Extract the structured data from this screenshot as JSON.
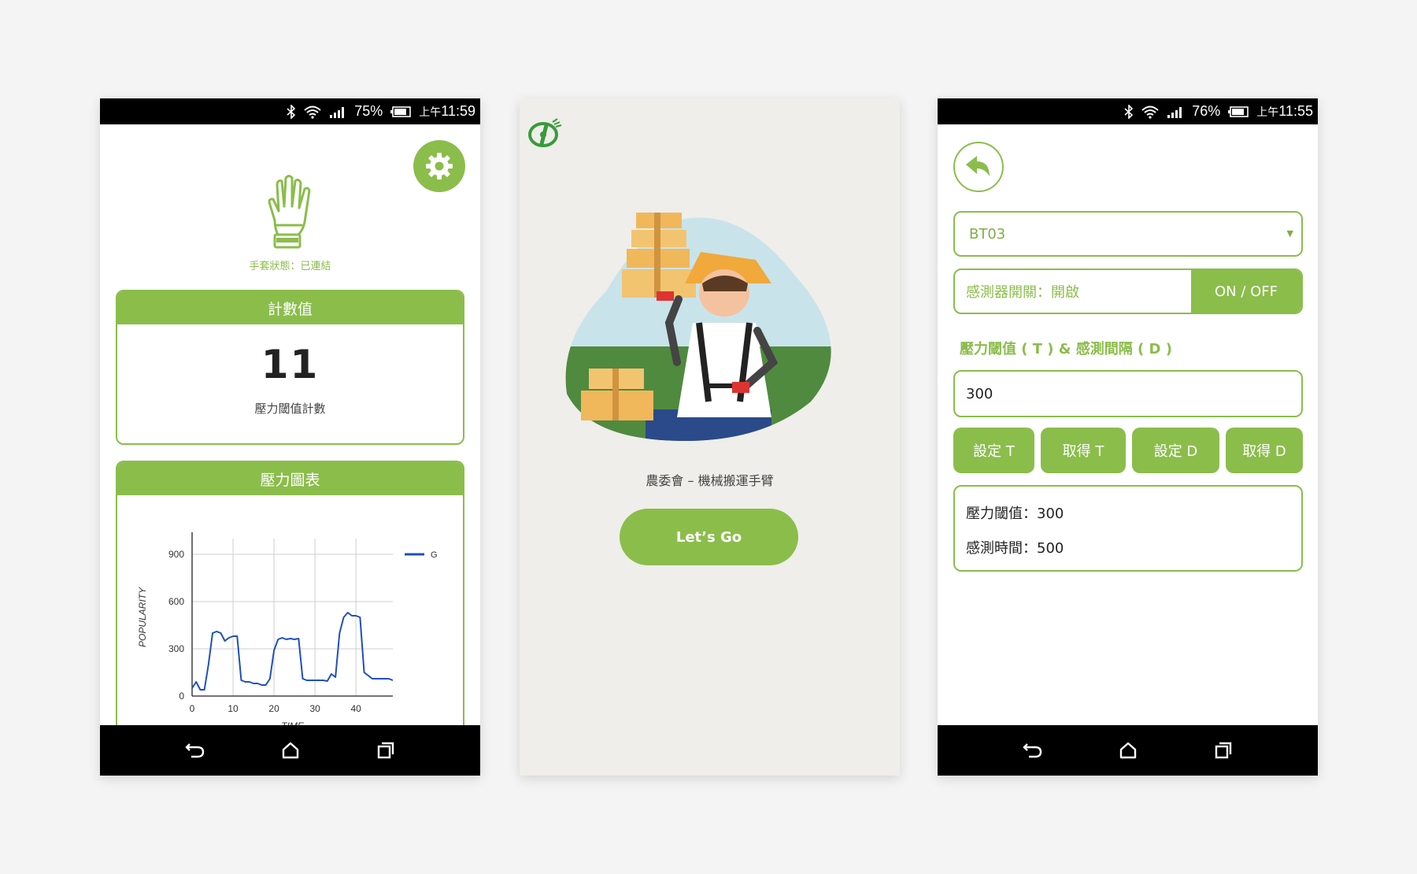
{
  "colors": {
    "accent": "#8bbd4b",
    "chart_line": "#1f4fbf"
  },
  "screen1": {
    "status": {
      "battery": "75%",
      "time_prefix": "上午",
      "time": "11:59"
    },
    "glove_status": "手套狀態：已連結",
    "count_card": {
      "title": "計數值",
      "value": "11",
      "caption": "壓力閾值計數"
    },
    "chart_card": {
      "title": "壓力圖表"
    }
  },
  "screen2": {
    "tagline": "農委會 – 機械搬運手臂",
    "button": "Let’s Go"
  },
  "screen3": {
    "status": {
      "battery": "76%",
      "time_prefix": "上午",
      "time": "11:55"
    },
    "device_select": "BT03",
    "sensor_switch_label": "感測器開關：開啟",
    "sensor_switch_button": "ON / OFF",
    "section_title": "壓力閾值 ( T ) & 感測間隔 ( D )",
    "input_value": "300",
    "buttons": [
      "設定 T",
      "取得 T",
      "設定 D",
      "取得 D"
    ],
    "result_threshold": "壓力閾值：300",
    "result_interval": "感測時間：500"
  },
  "chart_data": {
    "type": "line",
    "xlabel": "TIME",
    "ylabel": "POPULARITY",
    "xlim": [
      0,
      49
    ],
    "ylim": [
      0,
      1000
    ],
    "xticks": [
      0,
      10,
      20,
      30,
      40
    ],
    "yticks": [
      0,
      300,
      600,
      900
    ],
    "grid": true,
    "legend": "top-right",
    "series": [
      {
        "name": "G",
        "x": [
          0,
          1,
          2,
          3,
          4,
          5,
          6,
          7,
          8,
          9,
          10,
          11,
          12,
          13,
          14,
          15,
          16,
          17,
          18,
          19,
          20,
          21,
          22,
          23,
          24,
          25,
          26,
          27,
          28,
          29,
          30,
          31,
          32,
          33,
          34,
          35,
          36,
          37,
          38,
          39,
          40,
          41,
          42,
          43,
          44,
          45,
          46,
          47,
          48,
          49
        ],
        "y": [
          50,
          90,
          40,
          40,
          200,
          400,
          410,
          400,
          350,
          370,
          380,
          380,
          100,
          90,
          90,
          80,
          80,
          70,
          70,
          110,
          290,
          360,
          370,
          360,
          365,
          360,
          365,
          110,
          100,
          100,
          100,
          100,
          100,
          95,
          140,
          120,
          400,
          500,
          530,
          510,
          510,
          500,
          150,
          130,
          110,
          110,
          110,
          110,
          110,
          100
        ]
      }
    ]
  }
}
